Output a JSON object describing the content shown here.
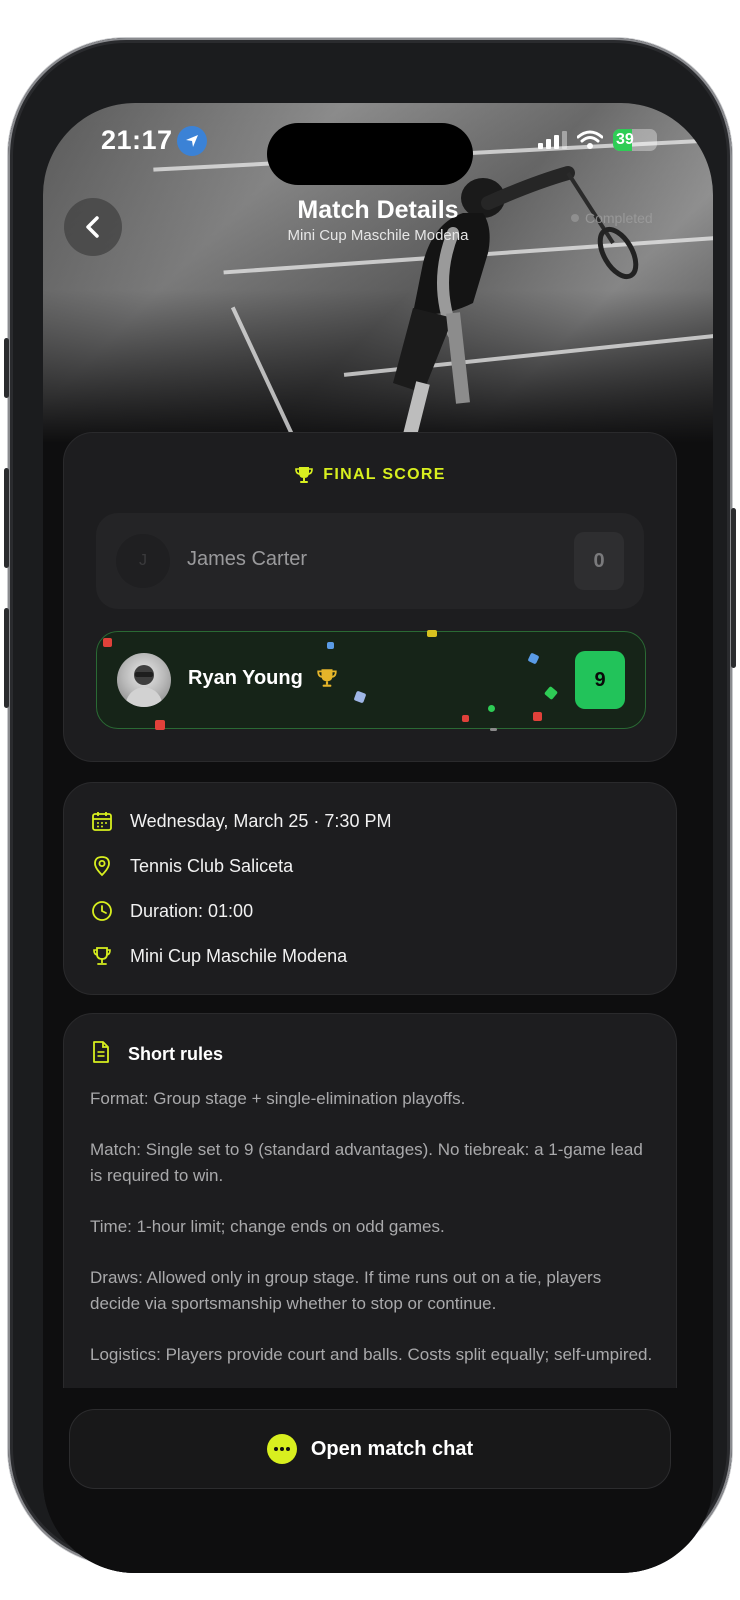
{
  "status_bar": {
    "time": "21:17",
    "battery": "39"
  },
  "header": {
    "title": "Match Details",
    "subtitle": "Mini Cup Maschile Modena",
    "status": "Completed"
  },
  "score": {
    "heading": "FINAL SCORE",
    "players": [
      {
        "initial": "J",
        "name": "James Carter",
        "score": "0",
        "winner": false
      },
      {
        "name": "Ryan Young",
        "score": "9",
        "winner": true
      }
    ]
  },
  "details": {
    "datetime": "Wednesday, March 25 · 7:30 PM",
    "venue": "Tennis Club Saliceta",
    "duration": "Duration: 01:00",
    "tournament": "Mini Cup Maschile Modena"
  },
  "rules": {
    "heading": "Short rules",
    "paragraphs": [
      "Format: Group stage + single-elimination playoffs.",
      "Match: Single set to 9 (standard advantages). No tiebreak: a 1-game lead is required to win.",
      "Time: 1-hour limit; change ends on odd games.",
      "Draws: Allowed only in group stage. If time runs out on a tie, players decide via sportsmanship whether to stop or continue.",
      "Logistics: Players provide court and balls. Costs split equally; self-umpired."
    ]
  },
  "chat_button": {
    "label": "Open match chat"
  },
  "colors": {
    "accent": "#d8ef1f",
    "winner_green": "#22c35a",
    "background": "#0e0e0f",
    "card": "#1d1d1f"
  },
  "icons": [
    "location-arrow-icon",
    "signal-icon",
    "wifi-icon",
    "battery-icon",
    "back-chevron-icon",
    "trophy-icon",
    "calendar-icon",
    "map-pin-icon",
    "clock-icon",
    "document-icon",
    "chat-bubble-icon"
  ]
}
